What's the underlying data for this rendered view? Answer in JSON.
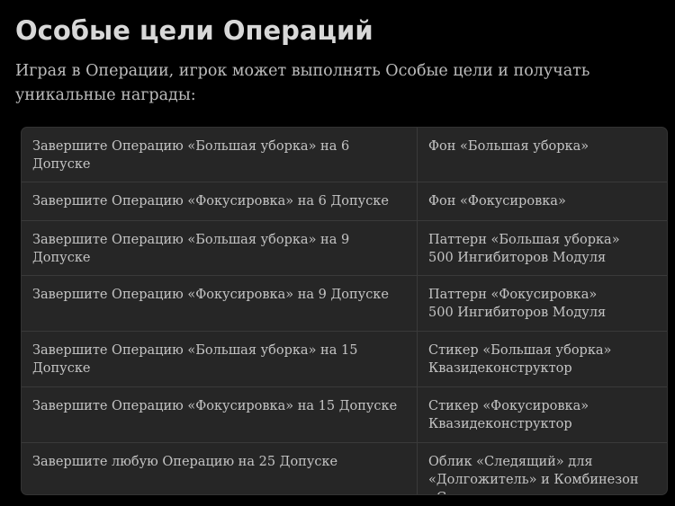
{
  "page": {
    "title": "Особые цели Операций",
    "intro": "Играя в Операции, игрок может выполнять Особые цели и получать уникальные награды:"
  },
  "table": {
    "rows": [
      {
        "condition": "Завершите Операцию «Большая уборка» на 6 Допуске",
        "reward": "Фон «Большая уборка»"
      },
      {
        "condition": "Завершите Операцию «Фокусировка» на 6 Допуске",
        "reward": "Фон «Фокусировка»"
      },
      {
        "condition": "Завершите Операцию «Большая уборка» на 9 Допуске",
        "reward": "Паттерн «Большая уборка»\n500 Ингибиторов Модуля"
      },
      {
        "condition": "Завершите Операцию «Фокусировка» на 9 Допуске",
        "reward": "Паттерн «Фокусировка»\n500 Ингибиторов Модуля"
      },
      {
        "condition": "Завершите Операцию «Большая уборка» на 15 Допуске",
        "reward": "Стикер «Большая уборка»\nКвазидеконструктор"
      },
      {
        "condition": "Завершите Операцию «Фокусировка» на 15 Допуске",
        "reward": "Стикер «Фокусировка»\nКвазидеконструктор"
      },
      {
        "condition": "Завершите любую Операцию на 25 Допуске",
        "reward": "Облик «Следящий» для\n«Долгожитель» и Комбинезон\n«Сатурн»"
      }
    ]
  }
}
